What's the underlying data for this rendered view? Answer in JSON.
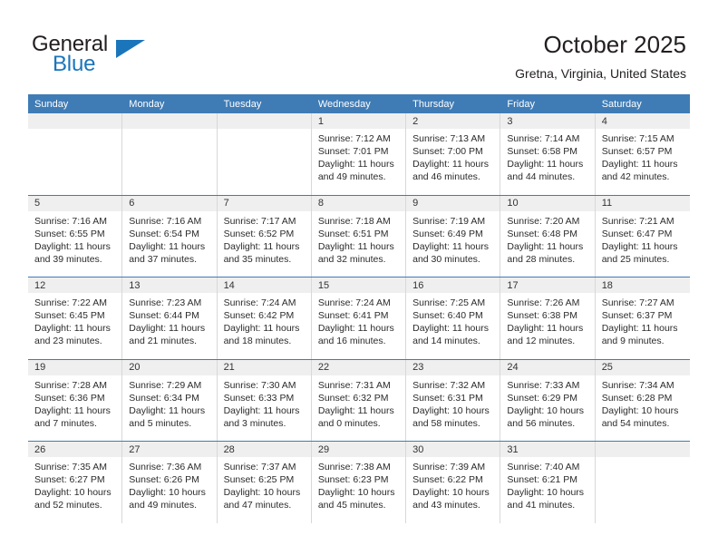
{
  "brand": {
    "line1": "General",
    "line2": "Blue",
    "primary_color": "#1b75bb",
    "text_color": "#231f20"
  },
  "header": {
    "title": "October 2025",
    "subtitle": "Gretna, Virginia, United States"
  },
  "theme": {
    "header_blue": "#3f7cb6",
    "day_band_grey": "#efefef",
    "cell_border": "#d8d8d8"
  },
  "weekdays": [
    "Sunday",
    "Monday",
    "Tuesday",
    "Wednesday",
    "Thursday",
    "Friday",
    "Saturday"
  ],
  "weeks": [
    [
      {
        "day": "",
        "empty": true
      },
      {
        "day": "",
        "empty": true
      },
      {
        "day": "",
        "empty": true
      },
      {
        "day": "1",
        "sunrise": "Sunrise: 7:12 AM",
        "sunset": "Sunset: 7:01 PM",
        "daylight1": "Daylight: 11 hours",
        "daylight2": "and 49 minutes."
      },
      {
        "day": "2",
        "sunrise": "Sunrise: 7:13 AM",
        "sunset": "Sunset: 7:00 PM",
        "daylight1": "Daylight: 11 hours",
        "daylight2": "and 46 minutes."
      },
      {
        "day": "3",
        "sunrise": "Sunrise: 7:14 AM",
        "sunset": "Sunset: 6:58 PM",
        "daylight1": "Daylight: 11 hours",
        "daylight2": "and 44 minutes."
      },
      {
        "day": "4",
        "sunrise": "Sunrise: 7:15 AM",
        "sunset": "Sunset: 6:57 PM",
        "daylight1": "Daylight: 11 hours",
        "daylight2": "and 42 minutes."
      }
    ],
    [
      {
        "day": "5",
        "sunrise": "Sunrise: 7:16 AM",
        "sunset": "Sunset: 6:55 PM",
        "daylight1": "Daylight: 11 hours",
        "daylight2": "and 39 minutes."
      },
      {
        "day": "6",
        "sunrise": "Sunrise: 7:16 AM",
        "sunset": "Sunset: 6:54 PM",
        "daylight1": "Daylight: 11 hours",
        "daylight2": "and 37 minutes."
      },
      {
        "day": "7",
        "sunrise": "Sunrise: 7:17 AM",
        "sunset": "Sunset: 6:52 PM",
        "daylight1": "Daylight: 11 hours",
        "daylight2": "and 35 minutes."
      },
      {
        "day": "8",
        "sunrise": "Sunrise: 7:18 AM",
        "sunset": "Sunset: 6:51 PM",
        "daylight1": "Daylight: 11 hours",
        "daylight2": "and 32 minutes."
      },
      {
        "day": "9",
        "sunrise": "Sunrise: 7:19 AM",
        "sunset": "Sunset: 6:49 PM",
        "daylight1": "Daylight: 11 hours",
        "daylight2": "and 30 minutes."
      },
      {
        "day": "10",
        "sunrise": "Sunrise: 7:20 AM",
        "sunset": "Sunset: 6:48 PM",
        "daylight1": "Daylight: 11 hours",
        "daylight2": "and 28 minutes."
      },
      {
        "day": "11",
        "sunrise": "Sunrise: 7:21 AM",
        "sunset": "Sunset: 6:47 PM",
        "daylight1": "Daylight: 11 hours",
        "daylight2": "and 25 minutes."
      }
    ],
    [
      {
        "day": "12",
        "sunrise": "Sunrise: 7:22 AM",
        "sunset": "Sunset: 6:45 PM",
        "daylight1": "Daylight: 11 hours",
        "daylight2": "and 23 minutes."
      },
      {
        "day": "13",
        "sunrise": "Sunrise: 7:23 AM",
        "sunset": "Sunset: 6:44 PM",
        "daylight1": "Daylight: 11 hours",
        "daylight2": "and 21 minutes."
      },
      {
        "day": "14",
        "sunrise": "Sunrise: 7:24 AM",
        "sunset": "Sunset: 6:42 PM",
        "daylight1": "Daylight: 11 hours",
        "daylight2": "and 18 minutes."
      },
      {
        "day": "15",
        "sunrise": "Sunrise: 7:24 AM",
        "sunset": "Sunset: 6:41 PM",
        "daylight1": "Daylight: 11 hours",
        "daylight2": "and 16 minutes."
      },
      {
        "day": "16",
        "sunrise": "Sunrise: 7:25 AM",
        "sunset": "Sunset: 6:40 PM",
        "daylight1": "Daylight: 11 hours",
        "daylight2": "and 14 minutes."
      },
      {
        "day": "17",
        "sunrise": "Sunrise: 7:26 AM",
        "sunset": "Sunset: 6:38 PM",
        "daylight1": "Daylight: 11 hours",
        "daylight2": "and 12 minutes."
      },
      {
        "day": "18",
        "sunrise": "Sunrise: 7:27 AM",
        "sunset": "Sunset: 6:37 PM",
        "daylight1": "Daylight: 11 hours",
        "daylight2": "and 9 minutes."
      }
    ],
    [
      {
        "day": "19",
        "sunrise": "Sunrise: 7:28 AM",
        "sunset": "Sunset: 6:36 PM",
        "daylight1": "Daylight: 11 hours",
        "daylight2": "and 7 minutes."
      },
      {
        "day": "20",
        "sunrise": "Sunrise: 7:29 AM",
        "sunset": "Sunset: 6:34 PM",
        "daylight1": "Daylight: 11 hours",
        "daylight2": "and 5 minutes."
      },
      {
        "day": "21",
        "sunrise": "Sunrise: 7:30 AM",
        "sunset": "Sunset: 6:33 PM",
        "daylight1": "Daylight: 11 hours",
        "daylight2": "and 3 minutes."
      },
      {
        "day": "22",
        "sunrise": "Sunrise: 7:31 AM",
        "sunset": "Sunset: 6:32 PM",
        "daylight1": "Daylight: 11 hours",
        "daylight2": "and 0 minutes."
      },
      {
        "day": "23",
        "sunrise": "Sunrise: 7:32 AM",
        "sunset": "Sunset: 6:31 PM",
        "daylight1": "Daylight: 10 hours",
        "daylight2": "and 58 minutes."
      },
      {
        "day": "24",
        "sunrise": "Sunrise: 7:33 AM",
        "sunset": "Sunset: 6:29 PM",
        "daylight1": "Daylight: 10 hours",
        "daylight2": "and 56 minutes."
      },
      {
        "day": "25",
        "sunrise": "Sunrise: 7:34 AM",
        "sunset": "Sunset: 6:28 PM",
        "daylight1": "Daylight: 10 hours",
        "daylight2": "and 54 minutes."
      }
    ],
    [
      {
        "day": "26",
        "sunrise": "Sunrise: 7:35 AM",
        "sunset": "Sunset: 6:27 PM",
        "daylight1": "Daylight: 10 hours",
        "daylight2": "and 52 minutes."
      },
      {
        "day": "27",
        "sunrise": "Sunrise: 7:36 AM",
        "sunset": "Sunset: 6:26 PM",
        "daylight1": "Daylight: 10 hours",
        "daylight2": "and 49 minutes."
      },
      {
        "day": "28",
        "sunrise": "Sunrise: 7:37 AM",
        "sunset": "Sunset: 6:25 PM",
        "daylight1": "Daylight: 10 hours",
        "daylight2": "and 47 minutes."
      },
      {
        "day": "29",
        "sunrise": "Sunrise: 7:38 AM",
        "sunset": "Sunset: 6:23 PM",
        "daylight1": "Daylight: 10 hours",
        "daylight2": "and 45 minutes."
      },
      {
        "day": "30",
        "sunrise": "Sunrise: 7:39 AM",
        "sunset": "Sunset: 6:22 PM",
        "daylight1": "Daylight: 10 hours",
        "daylight2": "and 43 minutes."
      },
      {
        "day": "31",
        "sunrise": "Sunrise: 7:40 AM",
        "sunset": "Sunset: 6:21 PM",
        "daylight1": "Daylight: 10 hours",
        "daylight2": "and 41 minutes."
      },
      {
        "day": "",
        "empty": true
      }
    ]
  ]
}
